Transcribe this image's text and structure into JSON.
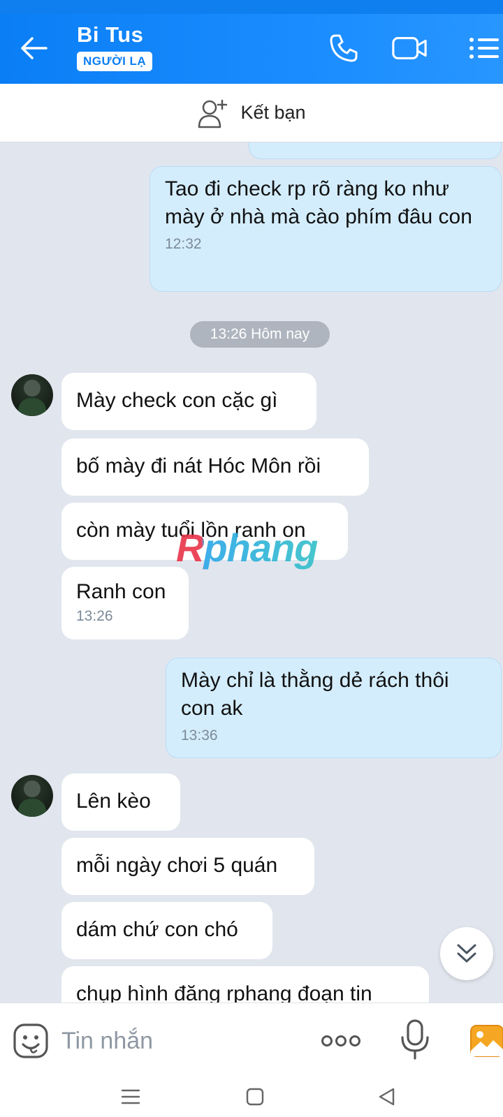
{
  "header": {
    "contact_name": "Bi Tus",
    "badge": "NGƯỜI LẠ"
  },
  "add_friend": {
    "label": "Kết bạn"
  },
  "date_separator": "13:26 Hôm nay",
  "messages": [
    {
      "direction": "out",
      "text": "Tao đi check rp rõ ràng ko như mày ở nhà mà cào phím đâu con",
      "time": "12:32"
    },
    {
      "direction": "in",
      "text": "Mày check con cặc gì"
    },
    {
      "direction": "in",
      "text": "bố mày đi nát Hóc Môn rồi"
    },
    {
      "direction": "in",
      "text": "còn mày tuổi lồn ranh on"
    },
    {
      "direction": "in",
      "text": "Ranh con",
      "time": "13:26"
    },
    {
      "direction": "out",
      "text": "Mày chỉ là thằng dẻ rách thôi con ak",
      "time": "13:36"
    },
    {
      "direction": "in",
      "text": "Lên kèo"
    },
    {
      "direction": "in",
      "text": "mỗi ngày chơi 5 quán"
    },
    {
      "direction": "in",
      "text": "dám chứ con chó"
    },
    {
      "direction": "in",
      "text": "chụp hình đăng rphang đoạn tin"
    }
  ],
  "watermark": "Rphang",
  "composer": {
    "placeholder": "Tin nhắn"
  },
  "icons": {
    "back": "arrow-left-icon",
    "call": "phone-icon",
    "video": "video-camera-icon",
    "menu": "list-menu-icon",
    "add_friend": "add-person-icon",
    "scroll_down": "double-chevron-down-icon",
    "emoji": "sticker-face-icon",
    "more": "more-dots-icon",
    "mic": "microphone-icon",
    "image": "image-gallery-icon"
  },
  "colors": {
    "header": "#0a7ef5",
    "outgoing_bubble": "#d4edfd",
    "incoming_bubble": "#ffffff",
    "chat_background": "#e1e6ee"
  }
}
